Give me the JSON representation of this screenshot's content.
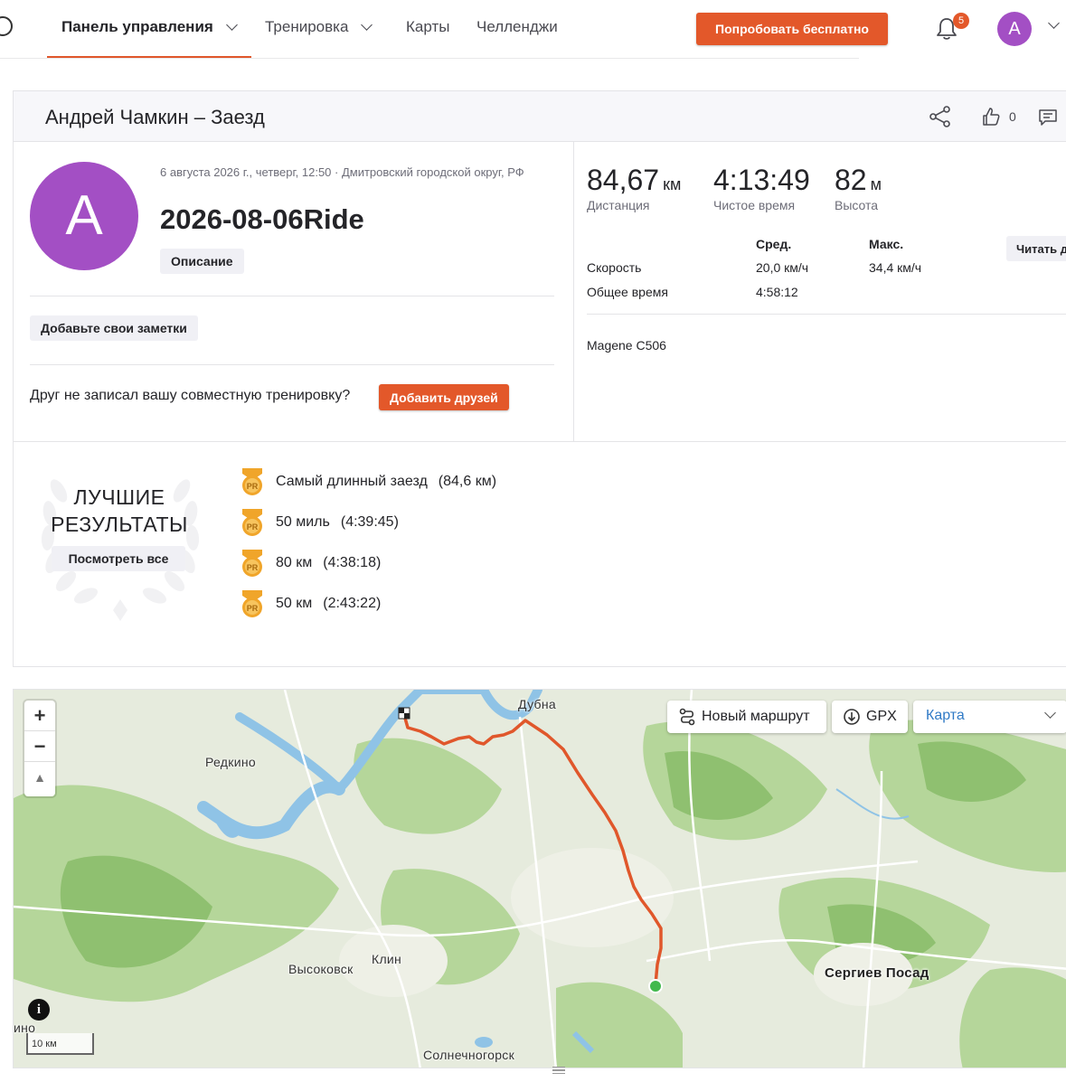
{
  "nav": {
    "items": [
      {
        "label": "Панель управления",
        "has_dropdown": true,
        "active": true
      },
      {
        "label": "Тренировка",
        "has_dropdown": true,
        "active": false
      },
      {
        "label": "Карты",
        "has_dropdown": false,
        "active": false
      },
      {
        "label": "Челленджи",
        "has_dropdown": false,
        "active": false
      }
    ],
    "try_button": "Попробовать бесплатно",
    "notification_count": "5",
    "avatar_initial": "A",
    "accent_color": "#e3582a"
  },
  "activity": {
    "header_title": "Андрей Чамкин – Заезд",
    "kudos_count": "0",
    "avatar_initial": "A",
    "avatar_color": "#a34fc4",
    "date_location": "6 августа 2026 г., четверг, 12:50 · Дмитровский городской округ, РФ",
    "name": "2026-08-06Ride",
    "description_label": "Описание",
    "notes_label": "Добавьте свои заметки",
    "friend_prompt": "Друг не записал вашу совместную тренировку?",
    "add_friends_button": "Добавить друзей"
  },
  "stats": {
    "distance": {
      "value": "84,67",
      "unit": "км",
      "label": "Дистанция"
    },
    "moving_time": {
      "value": "4:13:49",
      "label": "Чистое время"
    },
    "elevation": {
      "value": "82",
      "unit": "м",
      "label": "Высота"
    },
    "table": {
      "col_avg": "Сред.",
      "col_max": "Макс.",
      "rows": [
        {
          "label": "Скорость",
          "avg": "20,0 км/ч",
          "max": "34,4 км/ч"
        },
        {
          "label": "Общее время",
          "avg": "4:58:12",
          "max": ""
        }
      ]
    },
    "read_button": "Читать д",
    "device": "Magene C506"
  },
  "best_results": {
    "title_line1": "ЛУЧШИЕ",
    "title_line2": "РЕЗУЛЬТАТЫ",
    "see_all": "Посмотреть все",
    "medal_label": "PR",
    "items": [
      {
        "name": "Самый длинный заезд",
        "value": "(84,6 км)"
      },
      {
        "name": "50 миль",
        "value": "(4:39:45)"
      },
      {
        "name": "80 км",
        "value": "(4:38:18)"
      },
      {
        "name": "50 км",
        "value": "(2:43:22)"
      }
    ],
    "medal_color": "#f0a52a"
  },
  "map": {
    "zoom_in": "+",
    "zoom_out": "−",
    "compass": "▲",
    "new_route_button": "Новый маршрут",
    "gpx_button": "GPX",
    "map_type_select": "Карта",
    "route_color": "#e0572b",
    "info": "i",
    "scale_label": "10 км",
    "places": {
      "dubna": "Дубна",
      "redkino": "Редкино",
      "klin": "Клин",
      "vysokovsk": "Высоковск",
      "sergiev_posad": "Сергиев Посад",
      "solnechnogorsk": "Солнечногорск",
      "edge_fragment": "ино"
    }
  }
}
